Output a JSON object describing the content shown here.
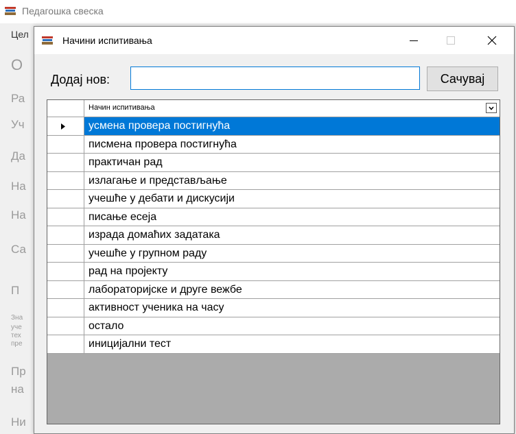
{
  "parent_window": {
    "title": "Педагошка свеска",
    "fragments": [
      "Цел",
      "О",
      "Ра",
      "Уч",
      "Да",
      "На",
      "На",
      "Са",
      "П",
      "Зна",
      "уче",
      "тех",
      "пре",
      "Пр",
      "на",
      "Ни"
    ]
  },
  "dialog": {
    "title": "Начини испитивања",
    "add_label": "Додај нов:",
    "add_input_value": "",
    "save_label": "Сачувај",
    "column_header": "Начин испитивања",
    "rows": [
      "усмена провера постигнућа",
      "писмена провера постигнућа",
      "практичан рад",
      "излагање и представљање",
      "учешће у дебати и дискусији",
      "писање есеја",
      "израда домаћих задатака",
      "учешће у групном раду",
      "рад на пројекту",
      "лабораторијске и друге вежбе",
      "активност ученика на часу",
      "остало",
      "иницијални тест"
    ],
    "selected_row": 0
  },
  "colors": {
    "selection": "#0078d7",
    "grid_background": "#ababab"
  },
  "icons": [
    "books-icon",
    "minimize-icon",
    "maximize-icon",
    "close-icon",
    "chevron-down-icon",
    "row-pointer-icon"
  ]
}
